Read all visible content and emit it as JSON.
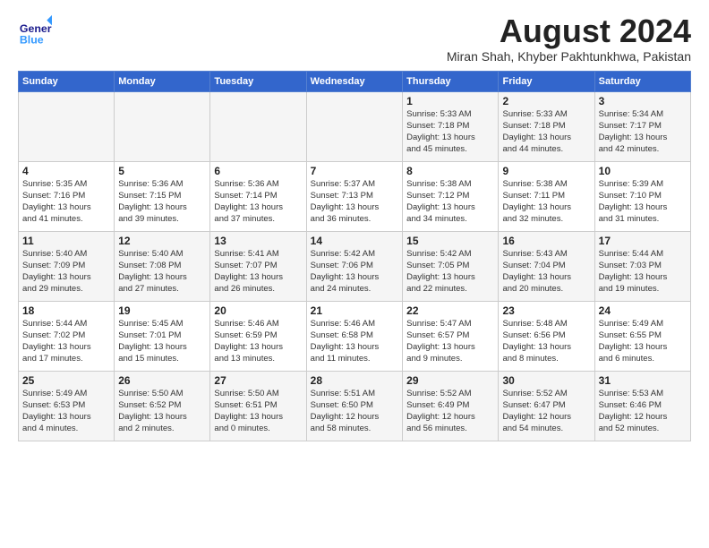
{
  "header": {
    "logo_general": "General",
    "logo_blue": "Blue",
    "month_title": "August 2024",
    "subtitle": "Miran Shah, Khyber Pakhtunkhwa, Pakistan"
  },
  "weekdays": [
    "Sunday",
    "Monday",
    "Tuesday",
    "Wednesday",
    "Thursday",
    "Friday",
    "Saturday"
  ],
  "rows": [
    [
      {
        "day": "",
        "info": ""
      },
      {
        "day": "",
        "info": ""
      },
      {
        "day": "",
        "info": ""
      },
      {
        "day": "",
        "info": ""
      },
      {
        "day": "1",
        "info": "Sunrise: 5:33 AM\nSunset: 7:18 PM\nDaylight: 13 hours\nand 45 minutes."
      },
      {
        "day": "2",
        "info": "Sunrise: 5:33 AM\nSunset: 7:18 PM\nDaylight: 13 hours\nand 44 minutes."
      },
      {
        "day": "3",
        "info": "Sunrise: 5:34 AM\nSunset: 7:17 PM\nDaylight: 13 hours\nand 42 minutes."
      }
    ],
    [
      {
        "day": "4",
        "info": "Sunrise: 5:35 AM\nSunset: 7:16 PM\nDaylight: 13 hours\nand 41 minutes."
      },
      {
        "day": "5",
        "info": "Sunrise: 5:36 AM\nSunset: 7:15 PM\nDaylight: 13 hours\nand 39 minutes."
      },
      {
        "day": "6",
        "info": "Sunrise: 5:36 AM\nSunset: 7:14 PM\nDaylight: 13 hours\nand 37 minutes."
      },
      {
        "day": "7",
        "info": "Sunrise: 5:37 AM\nSunset: 7:13 PM\nDaylight: 13 hours\nand 36 minutes."
      },
      {
        "day": "8",
        "info": "Sunrise: 5:38 AM\nSunset: 7:12 PM\nDaylight: 13 hours\nand 34 minutes."
      },
      {
        "day": "9",
        "info": "Sunrise: 5:38 AM\nSunset: 7:11 PM\nDaylight: 13 hours\nand 32 minutes."
      },
      {
        "day": "10",
        "info": "Sunrise: 5:39 AM\nSunset: 7:10 PM\nDaylight: 13 hours\nand 31 minutes."
      }
    ],
    [
      {
        "day": "11",
        "info": "Sunrise: 5:40 AM\nSunset: 7:09 PM\nDaylight: 13 hours\nand 29 minutes."
      },
      {
        "day": "12",
        "info": "Sunrise: 5:40 AM\nSunset: 7:08 PM\nDaylight: 13 hours\nand 27 minutes."
      },
      {
        "day": "13",
        "info": "Sunrise: 5:41 AM\nSunset: 7:07 PM\nDaylight: 13 hours\nand 26 minutes."
      },
      {
        "day": "14",
        "info": "Sunrise: 5:42 AM\nSunset: 7:06 PM\nDaylight: 13 hours\nand 24 minutes."
      },
      {
        "day": "15",
        "info": "Sunrise: 5:42 AM\nSunset: 7:05 PM\nDaylight: 13 hours\nand 22 minutes."
      },
      {
        "day": "16",
        "info": "Sunrise: 5:43 AM\nSunset: 7:04 PM\nDaylight: 13 hours\nand 20 minutes."
      },
      {
        "day": "17",
        "info": "Sunrise: 5:44 AM\nSunset: 7:03 PM\nDaylight: 13 hours\nand 19 minutes."
      }
    ],
    [
      {
        "day": "18",
        "info": "Sunrise: 5:44 AM\nSunset: 7:02 PM\nDaylight: 13 hours\nand 17 minutes."
      },
      {
        "day": "19",
        "info": "Sunrise: 5:45 AM\nSunset: 7:01 PM\nDaylight: 13 hours\nand 15 minutes."
      },
      {
        "day": "20",
        "info": "Sunrise: 5:46 AM\nSunset: 6:59 PM\nDaylight: 13 hours\nand 13 minutes."
      },
      {
        "day": "21",
        "info": "Sunrise: 5:46 AM\nSunset: 6:58 PM\nDaylight: 13 hours\nand 11 minutes."
      },
      {
        "day": "22",
        "info": "Sunrise: 5:47 AM\nSunset: 6:57 PM\nDaylight: 13 hours\nand 9 minutes."
      },
      {
        "day": "23",
        "info": "Sunrise: 5:48 AM\nSunset: 6:56 PM\nDaylight: 13 hours\nand 8 minutes."
      },
      {
        "day": "24",
        "info": "Sunrise: 5:49 AM\nSunset: 6:55 PM\nDaylight: 13 hours\nand 6 minutes."
      }
    ],
    [
      {
        "day": "25",
        "info": "Sunrise: 5:49 AM\nSunset: 6:53 PM\nDaylight: 13 hours\nand 4 minutes."
      },
      {
        "day": "26",
        "info": "Sunrise: 5:50 AM\nSunset: 6:52 PM\nDaylight: 13 hours\nand 2 minutes."
      },
      {
        "day": "27",
        "info": "Sunrise: 5:50 AM\nSunset: 6:51 PM\nDaylight: 13 hours\nand 0 minutes."
      },
      {
        "day": "28",
        "info": "Sunrise: 5:51 AM\nSunset: 6:50 PM\nDaylight: 12 hours\nand 58 minutes."
      },
      {
        "day": "29",
        "info": "Sunrise: 5:52 AM\nSunset: 6:49 PM\nDaylight: 12 hours\nand 56 minutes."
      },
      {
        "day": "30",
        "info": "Sunrise: 5:52 AM\nSunset: 6:47 PM\nDaylight: 12 hours\nand 54 minutes."
      },
      {
        "day": "31",
        "info": "Sunrise: 5:53 AM\nSunset: 6:46 PM\nDaylight: 12 hours\nand 52 minutes."
      }
    ]
  ]
}
